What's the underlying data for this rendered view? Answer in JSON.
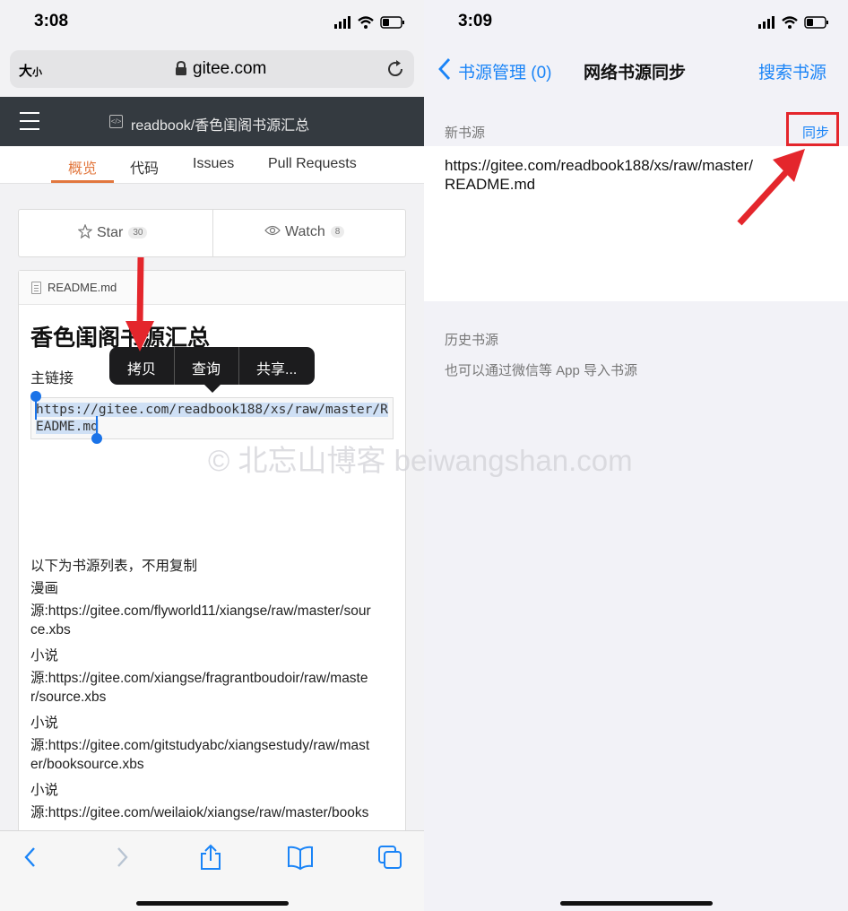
{
  "left": {
    "status": {
      "time": "3:08"
    },
    "urlbar": {
      "text_size_big": "大",
      "text_size_small": "小",
      "domain": "gitee.com"
    },
    "header": {
      "repo_title": "readbook/香色闺阁书源汇总"
    },
    "tabs": [
      "概览",
      "代码",
      "Issues",
      "Pull Requests"
    ],
    "active_tab": "概览",
    "star": {
      "label": "Star",
      "count": "30"
    },
    "watch": {
      "label": "Watch",
      "count": "8"
    },
    "readme": {
      "filename": "README.md",
      "title": "香色闺阁书源汇总",
      "subtitle": "主链接",
      "code_lines": [
        "https://gitee.com/readbook188/xs/raw/master/R",
        "EADME.md"
      ],
      "lines": [
        "以下为书源列表，不用复制",
        "漫画",
        "源:https://gitee.com/flyworld11/xiangse/raw/master/sour",
        "ce.xbs",
        "小说",
        "源:https://gitee.com/xiangse/fragrantboudoir/raw/maste",
        "r/source.xbs",
        "小说",
        "源:https://gitee.com/gitstudyabc/xiangsestudy/raw/mast",
        "er/booksource.xbs",
        "小说",
        "源:https://gitee.com/weilaiok/xiangse/raw/master/books"
      ]
    },
    "context_menu": [
      "拷贝",
      "查询",
      "共享..."
    ],
    "toolbar_icons": [
      "back-icon",
      "forward-icon",
      "share-icon",
      "bookmarks-icon",
      "tabs-icon"
    ]
  },
  "right": {
    "status": {
      "time": "3:09"
    },
    "nav": {
      "back_label": "书源管理 (0)",
      "title": "网络书源同步",
      "right_label": "搜索书源"
    },
    "new_source": {
      "label": "新书源",
      "sync_label": "同步",
      "url_lines": [
        "https://gitee.com/readbook188/xs/raw/master/",
        "README.md"
      ]
    },
    "history": {
      "label": "历史书源",
      "note": "也可以通过微信等 App 导入书源"
    }
  },
  "watermark": "© 北忘山博客 beiwangshan.com",
  "colors": {
    "accent_blue": "#1a84f7",
    "gitee_orange": "#e2773e",
    "highlight_red": "#e4262c",
    "header_dark": "#343a40"
  }
}
